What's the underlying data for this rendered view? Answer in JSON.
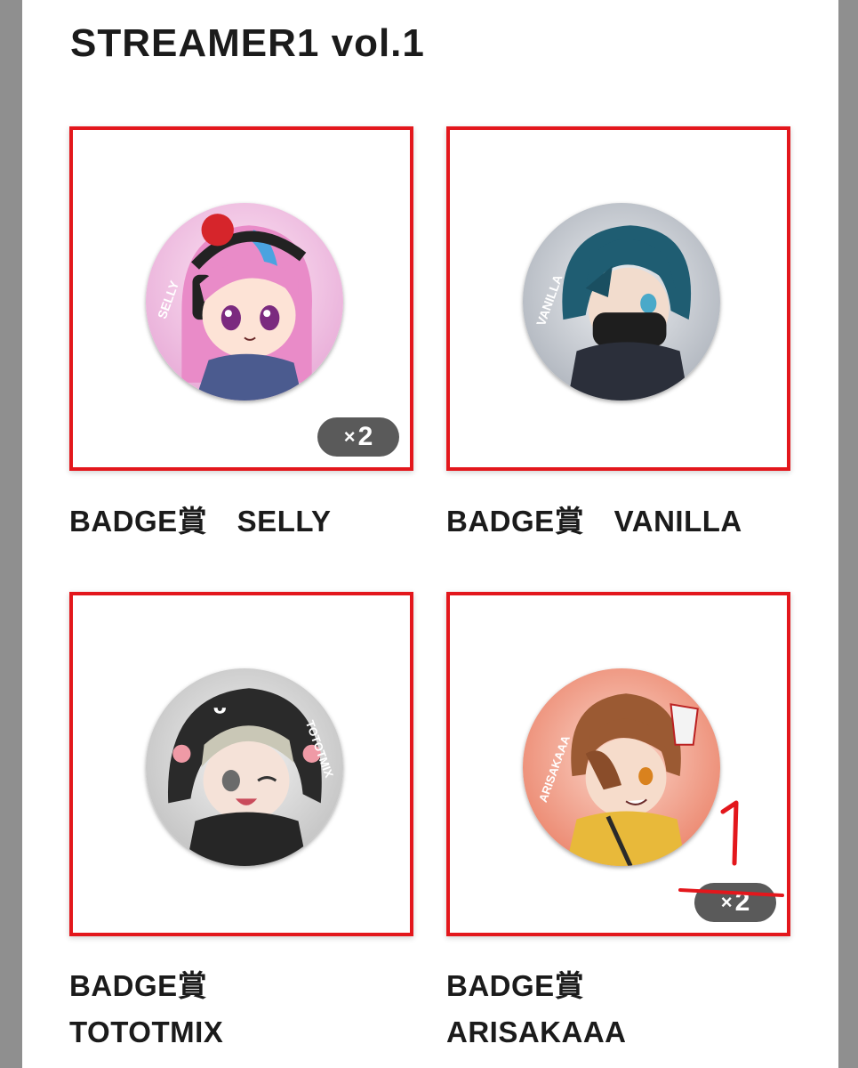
{
  "page": {
    "title": "STREAMER1 vol.1"
  },
  "items": [
    {
      "label": "BADGE賞　SELLY",
      "name": "SELLY",
      "quantity": "2",
      "quantity_prefix": "×",
      "badge_colors": {
        "bg": "#f0b8df",
        "hair": "#e98bc8",
        "accent": "#4aa3e0"
      }
    },
    {
      "label": "BADGE賞　VANILLA",
      "name": "VANILLA",
      "badge_colors": {
        "bg": "#c9ced6",
        "hair": "#1f5d72",
        "accent": "#1e1e1e"
      }
    },
    {
      "label_line1": "BADGE賞",
      "label_line2": "TOTOTMIX",
      "name": "TOTOTMIX",
      "badge_colors": {
        "bg": "#d8d8d8",
        "hair": "#c9c7b6",
        "accent": "#2a2a2a"
      }
    },
    {
      "label_line1": "BADGE賞",
      "label_line2": "ARISAKAAA",
      "name": "ARISAKAAA",
      "quantity": "2",
      "quantity_prefix": "×",
      "handwritten_note": "1",
      "badge_colors": {
        "bg": "#f2a08a",
        "hair": "#9b5a33",
        "accent": "#e8b93a"
      }
    }
  ],
  "annotation_color": "#e3171c"
}
